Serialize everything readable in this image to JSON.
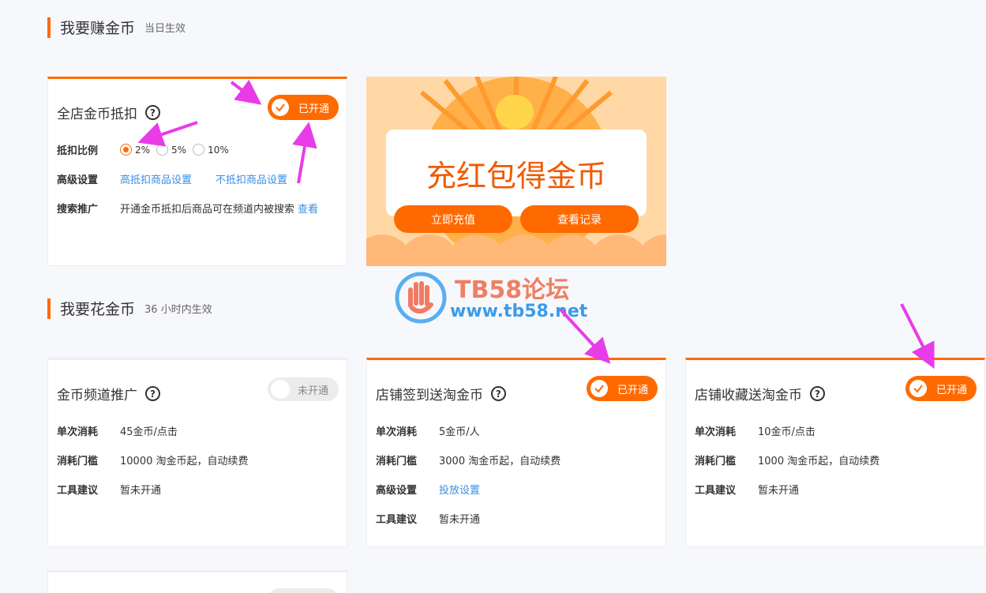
{
  "earn": {
    "title": "我要赚金币",
    "subtitle": "当日生效"
  },
  "spend": {
    "title": "我要花金币",
    "subtitle": "36 小时内生效"
  },
  "deduct": {
    "title": "全店金币抵扣",
    "help": "?",
    "toggle": "已开通",
    "rate_label": "抵扣比例",
    "rates": [
      "2%",
      "5%",
      "10%"
    ],
    "selected_rate": "2%",
    "advanced_label": "高级设置",
    "link1": "高抵扣商品设置",
    "link2": "不抵扣商品设置",
    "search_label": "搜索推广",
    "search_text": "开通金币抵扣后商品可在频道内被搜索",
    "search_link": "查看"
  },
  "banner": {
    "text": "充红包得金币",
    "btn1": "立即充值",
    "btn2": "查看记录"
  },
  "watermark": {
    "title": "TB58论坛",
    "url": "www.tb58.net"
  },
  "channel": {
    "title": "金币频道推广",
    "help": "?",
    "toggle": "未开通",
    "cost_label": "单次消耗",
    "cost": "45金币/点击",
    "threshold_label": "消耗门槛",
    "threshold": "10000 淘金币起，自动续费",
    "tool_label": "工具建议",
    "tool": "暂未开通"
  },
  "checkin": {
    "title": "店铺签到送淘金币",
    "help": "?",
    "toggle": "已开通",
    "cost_label": "单次消耗",
    "cost": "5金币/人",
    "threshold_label": "消耗门槛",
    "threshold": "3000 淘金币起，自动续费",
    "advanced_label": "高级设置",
    "advanced_link": "投放设置",
    "tool_label": "工具建议",
    "tool": "暂未开通"
  },
  "favorite": {
    "title": "店铺收藏送淘金币",
    "help": "?",
    "toggle": "已开通",
    "cost_label": "单次消耗",
    "cost": "10金币/点击",
    "threshold_label": "消耗门槛",
    "threshold": "1000 淘金币起，自动续费",
    "tool_label": "工具建议",
    "tool": "暂未开通"
  },
  "colors": {
    "accent": "#ff6a00",
    "link": "#3a8ee6",
    "arrow": "#e83ce8"
  }
}
